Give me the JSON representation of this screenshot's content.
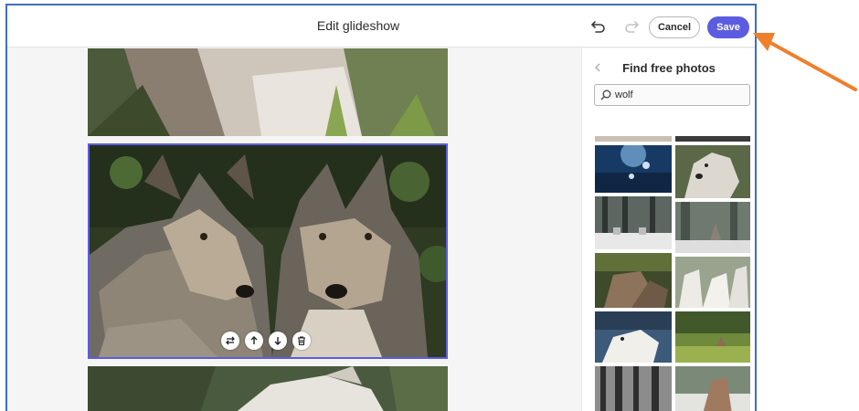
{
  "header": {
    "title": "Edit glideshow",
    "cancel_label": "Cancel",
    "save_label": "Save"
  },
  "panel": {
    "title": "Find free photos",
    "search_value": "wolf"
  },
  "colors": {
    "accent": "#5c5ce0",
    "frame_border": "#3d6fc4",
    "annotation_arrow": "#f07f2a"
  },
  "icons": {
    "undo": "undo-icon",
    "redo": "redo-icon",
    "back": "chevron-left-icon",
    "search": "search-icon",
    "replace": "swap-icon",
    "move_up": "arrow-up-icon",
    "move_down": "arrow-down-icon",
    "delete": "trash-icon"
  }
}
